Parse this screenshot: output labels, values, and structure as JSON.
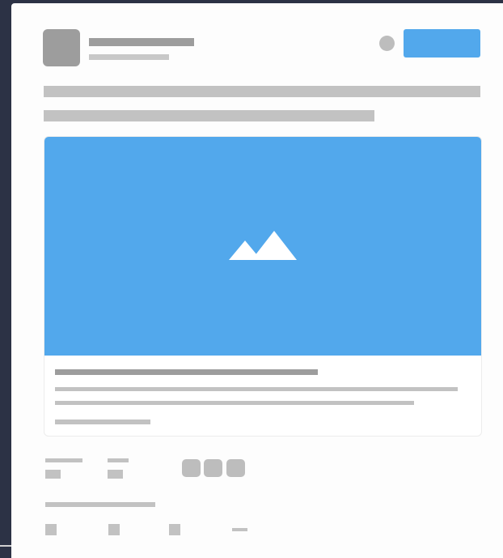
{
  "colors": {
    "background": "#2c3245",
    "card": "#fdfdfd",
    "accent": "#52a8ec",
    "placeholder_dark": "#9d9d9d",
    "placeholder_light": "#c2c2c2"
  },
  "header": {
    "avatar_icon": "avatar-placeholder",
    "status_icon": "status-dot"
  },
  "media_card": {
    "image_icon": "mountain-icon"
  },
  "reactions": {
    "count": 3
  },
  "footer": {
    "item_count": 3
  }
}
